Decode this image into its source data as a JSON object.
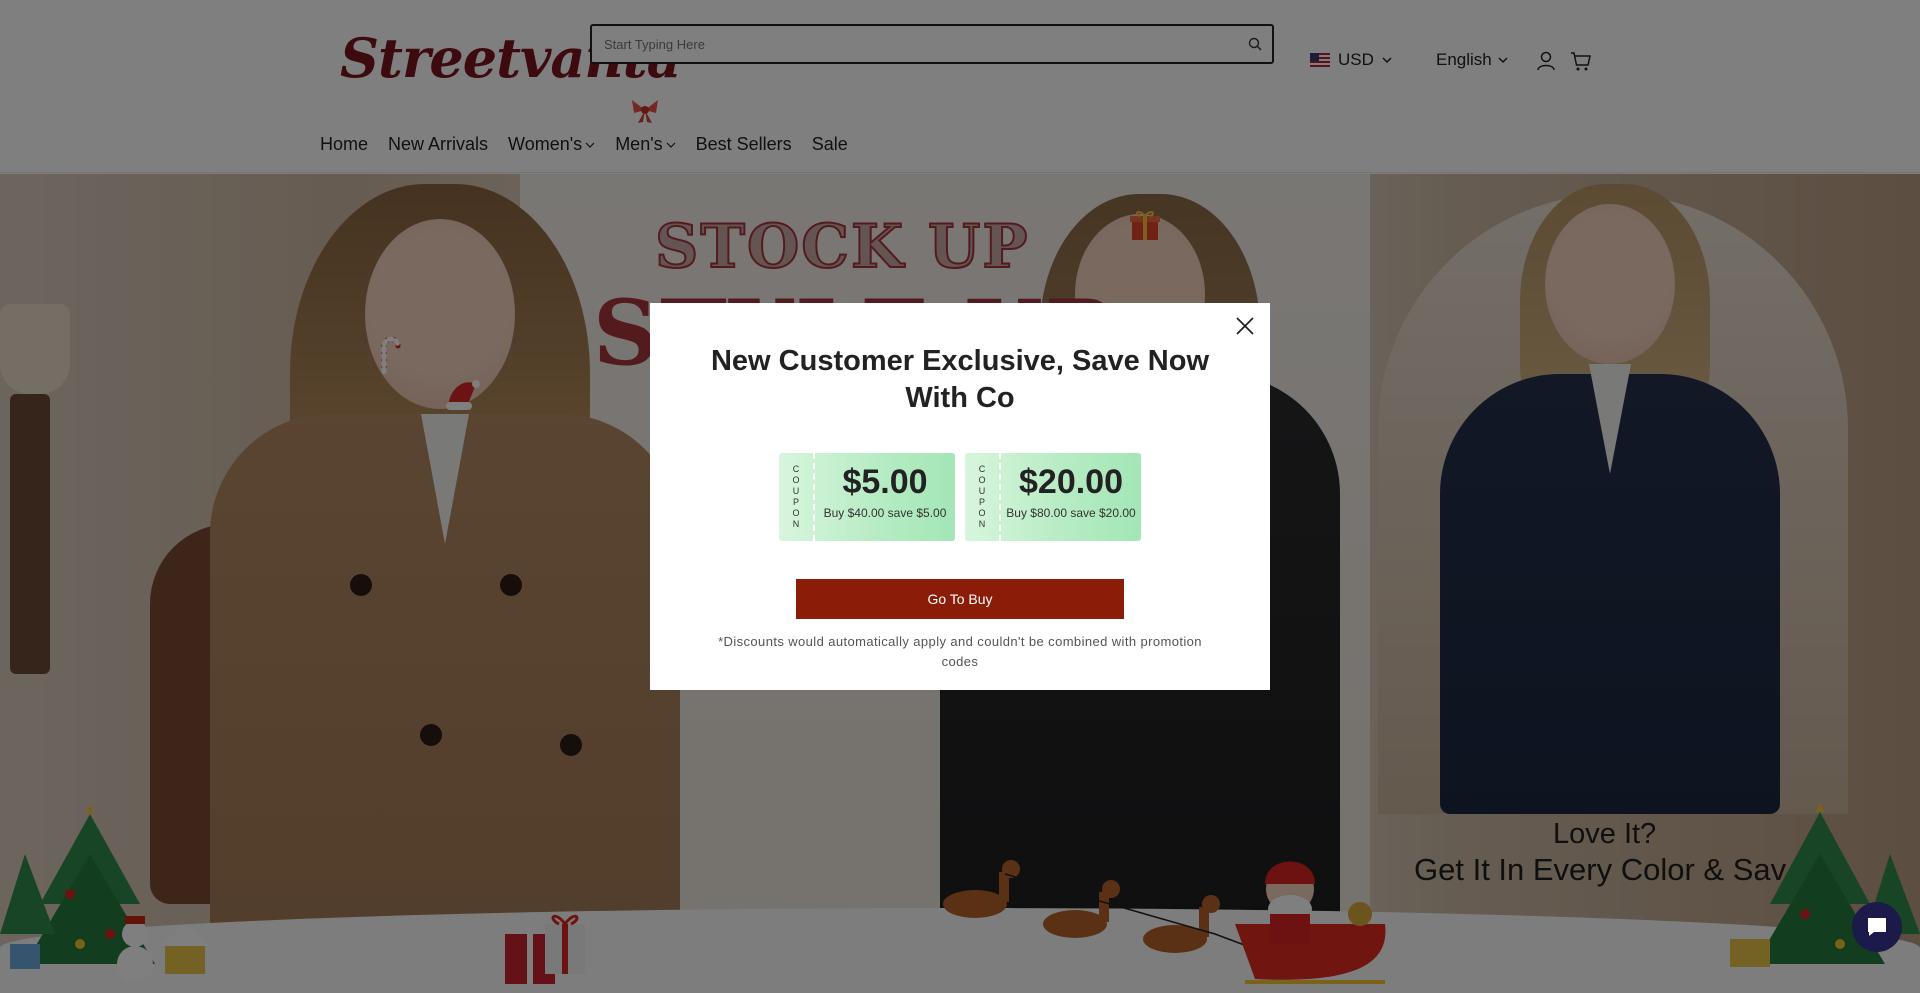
{
  "header": {
    "logo_text": "Streetvanta",
    "search_placeholder": "Start Typing Here",
    "currency": "USD",
    "language": "English"
  },
  "nav": {
    "items": [
      {
        "label": "Home"
      },
      {
        "label": "New Arrivals"
      },
      {
        "label": "Women's"
      },
      {
        "label": "Men's"
      },
      {
        "label": "Best Sellers"
      },
      {
        "label": "Sale"
      }
    ]
  },
  "hero": {
    "headline_1": "STOCK UP",
    "headline_2": "STYLE UP",
    "tagline_1": "Love It?",
    "tagline_2": "Get It In Every Color & Sav"
  },
  "modal": {
    "title": "New Customer Exclusive, Save Now With Co",
    "coupon_word_letters": [
      "C",
      "O",
      "U",
      "P",
      "O",
      "N"
    ],
    "coupons": [
      {
        "amount": "$5.00",
        "description": "Buy $40.00 save $5.00"
      },
      {
        "amount": "$20.00",
        "description": "Buy $80.00 save $20.00"
      }
    ],
    "button_label": "Go To Buy",
    "disclaimer": "*Discounts would automatically apply and couldn't be combined with promotion codes"
  },
  "colors": {
    "brand": "#7a1420",
    "button": "#8b1c08",
    "coupon_green": "#b7ecc4",
    "chat": "#1b1a4a"
  }
}
